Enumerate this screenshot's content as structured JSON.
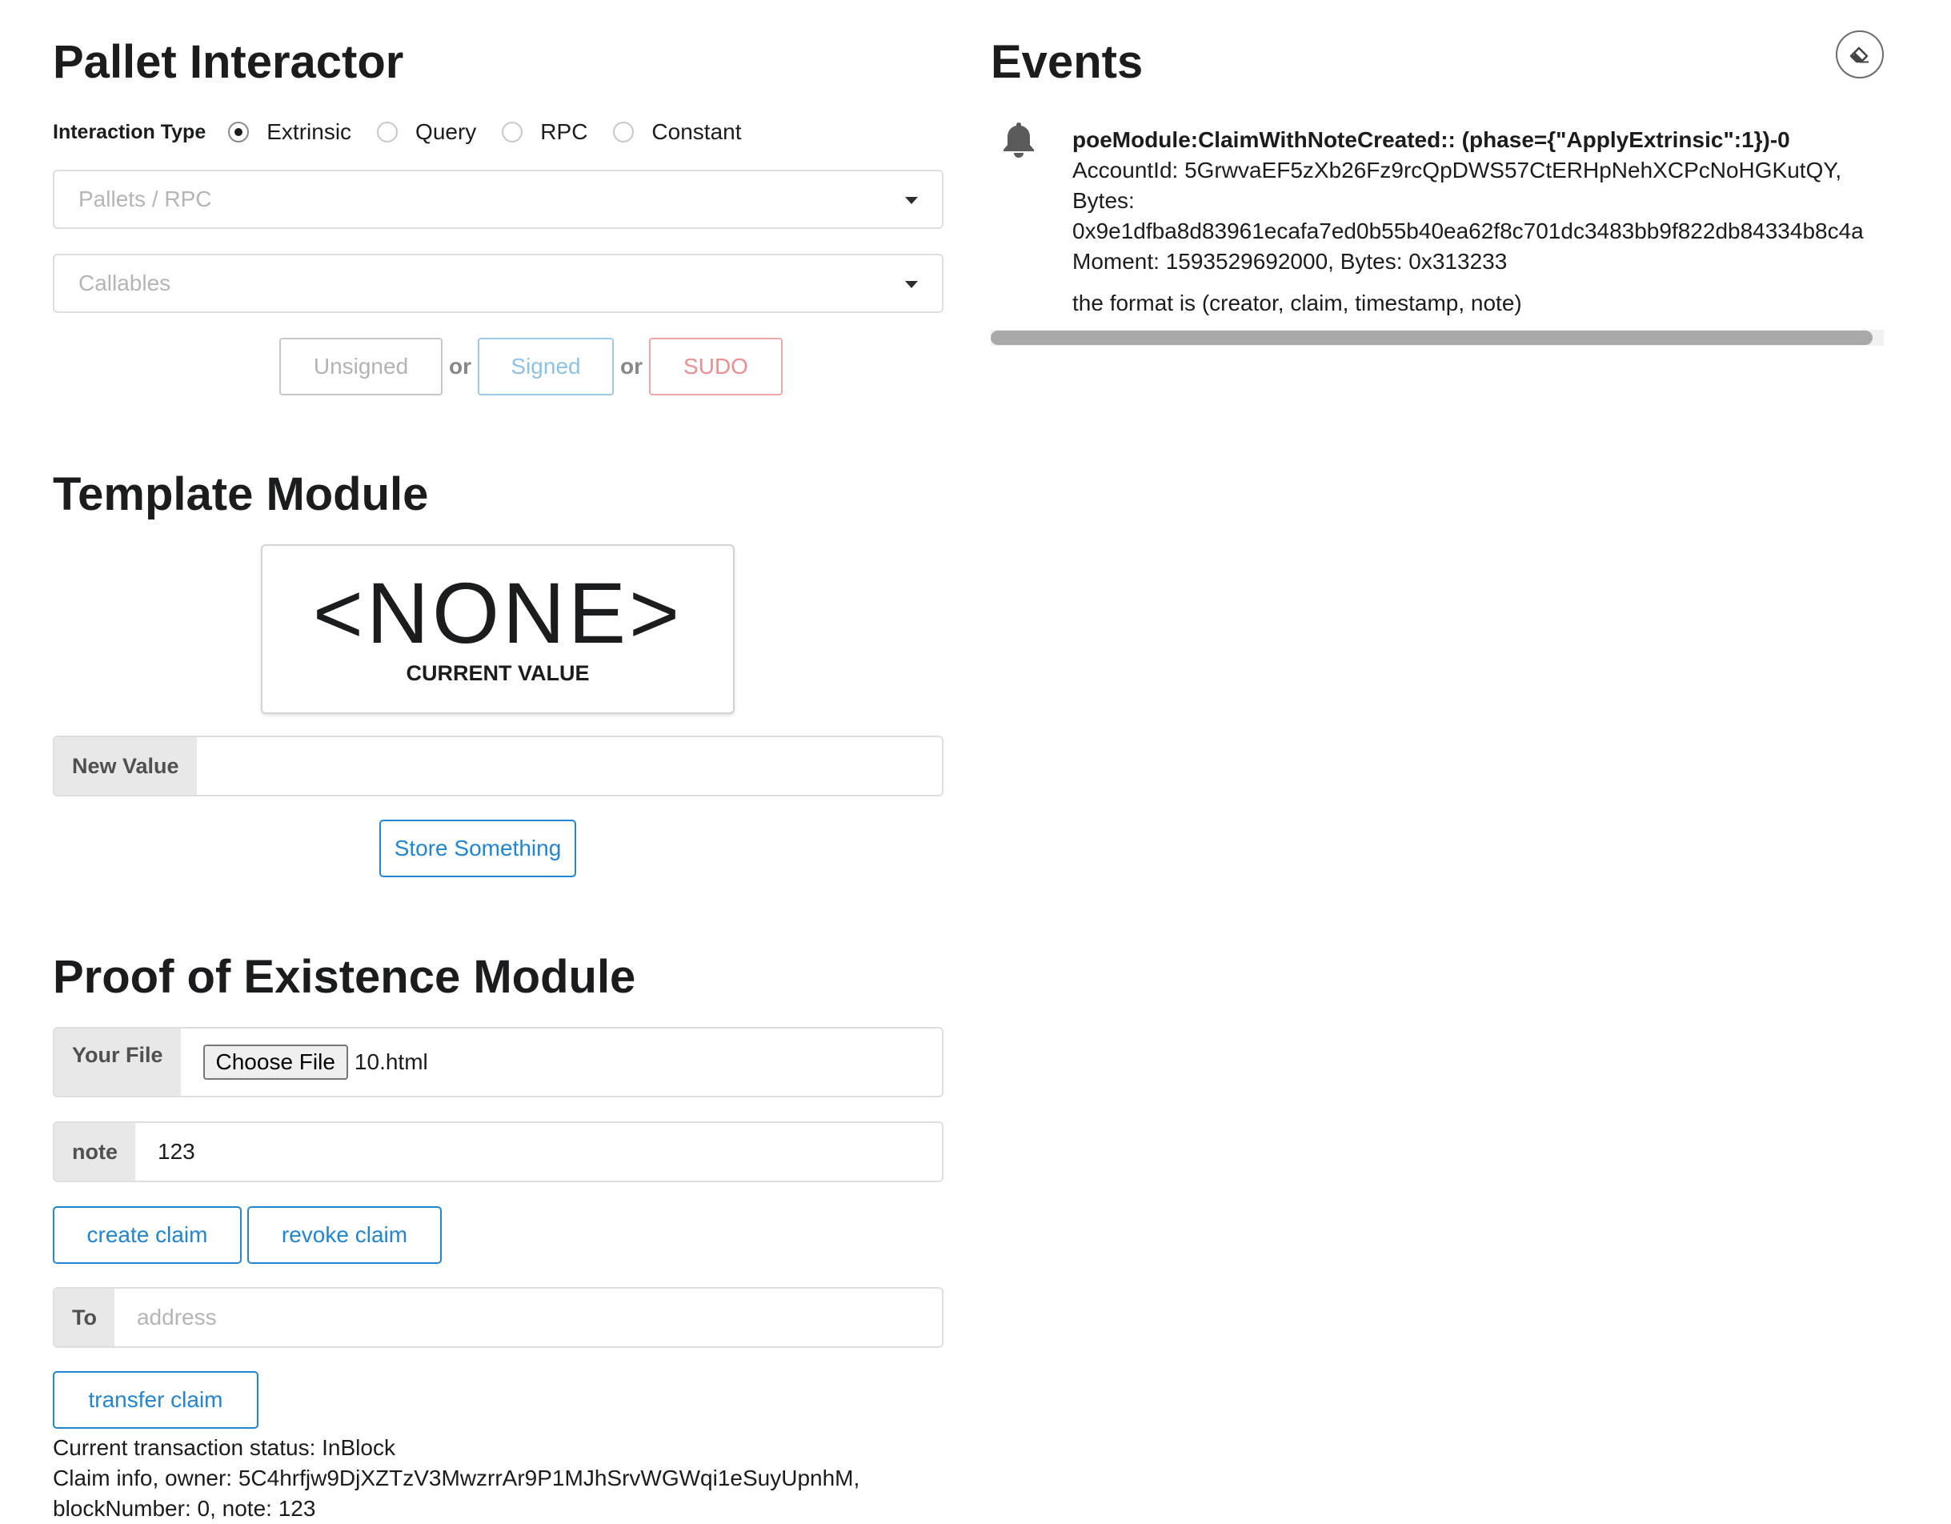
{
  "pallet_interactor": {
    "title": "Pallet Interactor",
    "interaction_type_label": "Interaction Type",
    "options": [
      {
        "label": "Extrinsic",
        "checked": true
      },
      {
        "label": "Query",
        "checked": false
      },
      {
        "label": "RPC",
        "checked": false
      },
      {
        "label": "Constant",
        "checked": false
      }
    ],
    "pallets_placeholder": "Pallets / RPC",
    "callables_placeholder": "Callables",
    "unsigned_label": "Unsigned",
    "signed_label": "Signed",
    "sudo_label": "SUDO",
    "or_label": "or"
  },
  "template_module": {
    "title": "Template Module",
    "current_value": "<NONE>",
    "current_value_caption": "CURRENT VALUE",
    "new_value_label": "New Value",
    "new_value_input": "",
    "store_button": "Store Something"
  },
  "poe_module": {
    "title": "Proof of Existence Module",
    "file_label": "Your File",
    "choose_file_button": "Choose File",
    "file_name": "10.html",
    "note_label": "note",
    "note_value": "123",
    "create_claim_button": "create claim",
    "revoke_claim_button": "revoke claim",
    "to_label": "To",
    "to_placeholder": "address",
    "transfer_claim_button": "transfer claim",
    "status_line": "Current transaction status: InBlock",
    "claim_info_line1": "Claim info, owner: 5C4hrfjw9DjXZTzV3MwzrrAr9P1MJhSrvWGWqi1eSuyUpnhM,",
    "claim_info_line2": "blockNumber: 0, note: 123"
  },
  "events": {
    "title": "Events",
    "clear_icon": "eraser-icon",
    "items": [
      {
        "icon": "bell-icon",
        "title": "poeModule:ClaimWithNoteCreated:: (phase={\"ApplyExtrinsic\":1})-0",
        "line1": "AccountId: 5GrwvaEF5zXb26Fz9rcQpDWS57CtERHpNehXCPcNoHGKutQY,",
        "line2": "Bytes:",
        "line3": "0x9e1dfba8d83961ecafa7ed0b55b40ea62f8c701dc3483bb9f822db84334b8c4a",
        "line4": "Moment: 1593529692000, Bytes: 0x313233",
        "note": "the format is (creator, claim, timestamp, note)"
      }
    ]
  },
  "colors": {
    "primary": "#2185d0",
    "sudo": "#ec8e8e",
    "signed": "#8cc2e6",
    "text": "#1b1c1d"
  }
}
